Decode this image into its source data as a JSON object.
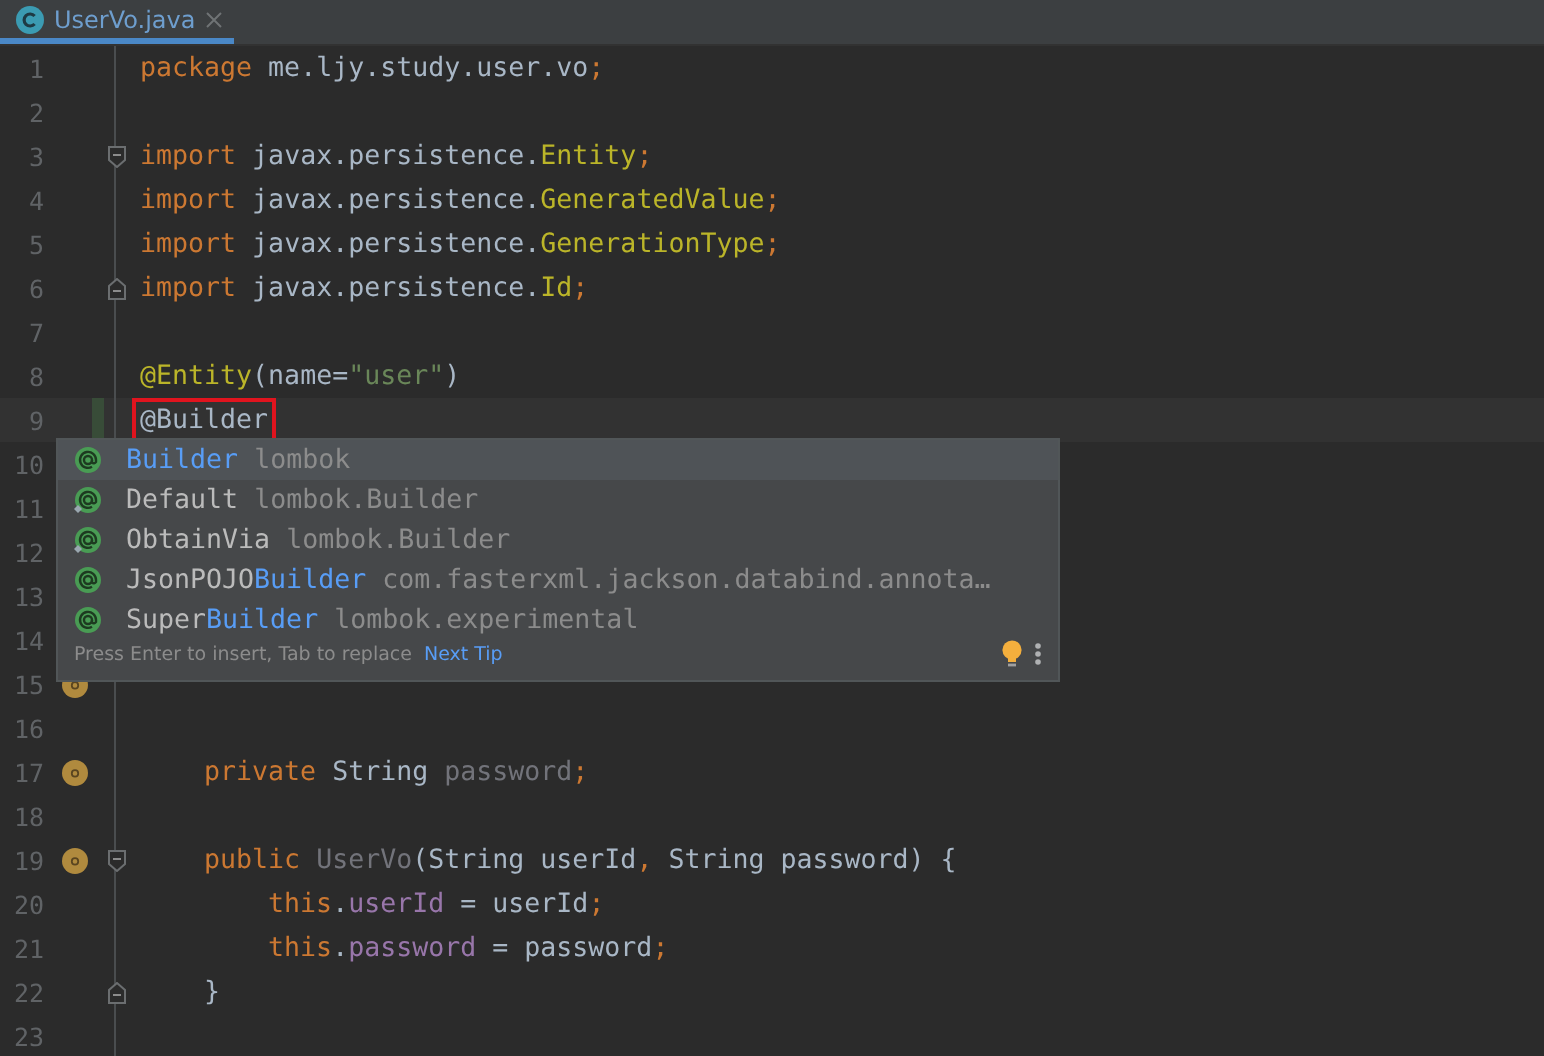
{
  "tabs": [
    {
      "label": "UserVo.java",
      "selected": true
    }
  ],
  "editor": {
    "lines": [
      {
        "number": "1",
        "kind": "top",
        "tokens": [
          {
            "text": "package",
            "kind": "keyword"
          },
          {
            "text": " me.ljy.study.user.vo",
            "kind": "plain"
          },
          {
            "text": ";",
            "kind": "keyword"
          }
        ]
      },
      {
        "number": "2"
      },
      {
        "number": "3",
        "kind": "top",
        "fold_start": true,
        "tokens": [
          {
            "text": "import",
            "kind": "keyword"
          },
          {
            "text": " javax.persistence.",
            "kind": "plain"
          },
          {
            "text": "Entity",
            "kind": "annotation"
          },
          {
            "text": ";",
            "kind": "keyword"
          }
        ]
      },
      {
        "number": "4",
        "kind": "top",
        "tokens": [
          {
            "text": "import",
            "kind": "keyword"
          },
          {
            "text": " javax.persistence.",
            "kind": "plain"
          },
          {
            "text": "GeneratedValue",
            "kind": "annotation"
          },
          {
            "text": ";",
            "kind": "keyword"
          }
        ]
      },
      {
        "number": "5",
        "kind": "top",
        "tokens": [
          {
            "text": "import",
            "kind": "keyword"
          },
          {
            "text": " javax.persistence.",
            "kind": "plain"
          },
          {
            "text": "GenerationType",
            "kind": "annotation"
          },
          {
            "text": ";",
            "kind": "keyword"
          }
        ]
      },
      {
        "number": "6",
        "kind": "top",
        "fold_end": true,
        "tokens": [
          {
            "text": "import",
            "kind": "keyword"
          },
          {
            "text": " javax.persistence.",
            "kind": "plain"
          },
          {
            "text": "Id",
            "kind": "annotation"
          },
          {
            "text": ";",
            "kind": "keyword"
          }
        ]
      },
      {
        "number": "7"
      },
      {
        "number": "8",
        "kind": "top",
        "tokens": [
          {
            "text": "@Entity",
            "kind": "annotation"
          },
          {
            "text": "(name=",
            "kind": "plain"
          },
          {
            "text": "\"user\"",
            "kind": "string"
          },
          {
            "text": ")",
            "kind": "plain"
          }
        ]
      },
      {
        "number": "9",
        "kind": "top",
        "current": true,
        "changed": true,
        "boxed": true,
        "tokens": [
          {
            "text": "@Builder",
            "kind": "plain"
          }
        ]
      },
      {
        "number": "10"
      },
      {
        "number": "11"
      },
      {
        "number": "12"
      },
      {
        "number": "13"
      },
      {
        "number": "14"
      },
      {
        "number": "15",
        "gutter_icon": true
      },
      {
        "number": "16"
      },
      {
        "number": "17",
        "kind": "member",
        "gutter_icon": true,
        "tokens": [
          {
            "text": "private",
            "kind": "keyword"
          },
          {
            "text": " String ",
            "kind": "plain"
          },
          {
            "text": "password",
            "kind": "unused"
          },
          {
            "text": ";",
            "kind": "keyword"
          }
        ]
      },
      {
        "number": "18"
      },
      {
        "number": "19",
        "kind": "member",
        "gutter_icon": true,
        "fold_start": true,
        "tokens": [
          {
            "text": "public",
            "kind": "keyword"
          },
          {
            "text": " UserVo",
            "kind": "unused"
          },
          {
            "text": "(String userId",
            "kind": "plain"
          },
          {
            "text": ",",
            "kind": "keyword"
          },
          {
            "text": " String password) {",
            "kind": "plain"
          }
        ]
      },
      {
        "number": "20",
        "kind": "statement",
        "tokens": [
          {
            "text": "this",
            "kind": "keyword"
          },
          {
            "text": ".",
            "kind": "plain"
          },
          {
            "text": "userId",
            "kind": "field"
          },
          {
            "text": " = userId",
            "kind": "plain"
          },
          {
            "text": ";",
            "kind": "keyword"
          }
        ]
      },
      {
        "number": "21",
        "kind": "statement",
        "tokens": [
          {
            "text": "this",
            "kind": "keyword"
          },
          {
            "text": ".",
            "kind": "plain"
          },
          {
            "text": "password",
            "kind": "field"
          },
          {
            "text": " = password",
            "kind": "plain"
          },
          {
            "text": ";",
            "kind": "keyword"
          }
        ]
      },
      {
        "number": "22",
        "kind": "member",
        "fold_end": true,
        "tokens": [
          {
            "text": "}",
            "kind": "plain"
          }
        ]
      },
      {
        "number": "23"
      }
    ]
  },
  "completion": {
    "items": [
      {
        "name": [
          {
            "text": "Builder",
            "match": true
          }
        ],
        "detail": "lombok",
        "selected": true,
        "overlay": false
      },
      {
        "name": [
          {
            "text": "Default",
            "match": false
          }
        ],
        "detail": "lombok.Builder",
        "selected": false,
        "overlay": true
      },
      {
        "name": [
          {
            "text": "ObtainVia",
            "match": false
          }
        ],
        "detail": "lombok.Builder",
        "selected": false,
        "overlay": true
      },
      {
        "name": [
          {
            "text": "JsonPOJO",
            "match": false
          },
          {
            "text": "Builder",
            "match": true
          }
        ],
        "detail": "com.fasterxml.jackson.databind.annota…",
        "selected": false,
        "overlay": false
      },
      {
        "name": [
          {
            "text": "Super",
            "match": false
          },
          {
            "text": "Builder",
            "match": true
          }
        ],
        "detail": "lombok.experimental",
        "selected": false,
        "overlay": false
      }
    ],
    "hint": "Press Enter to insert, Tab to replace",
    "link": "Next Tip"
  }
}
